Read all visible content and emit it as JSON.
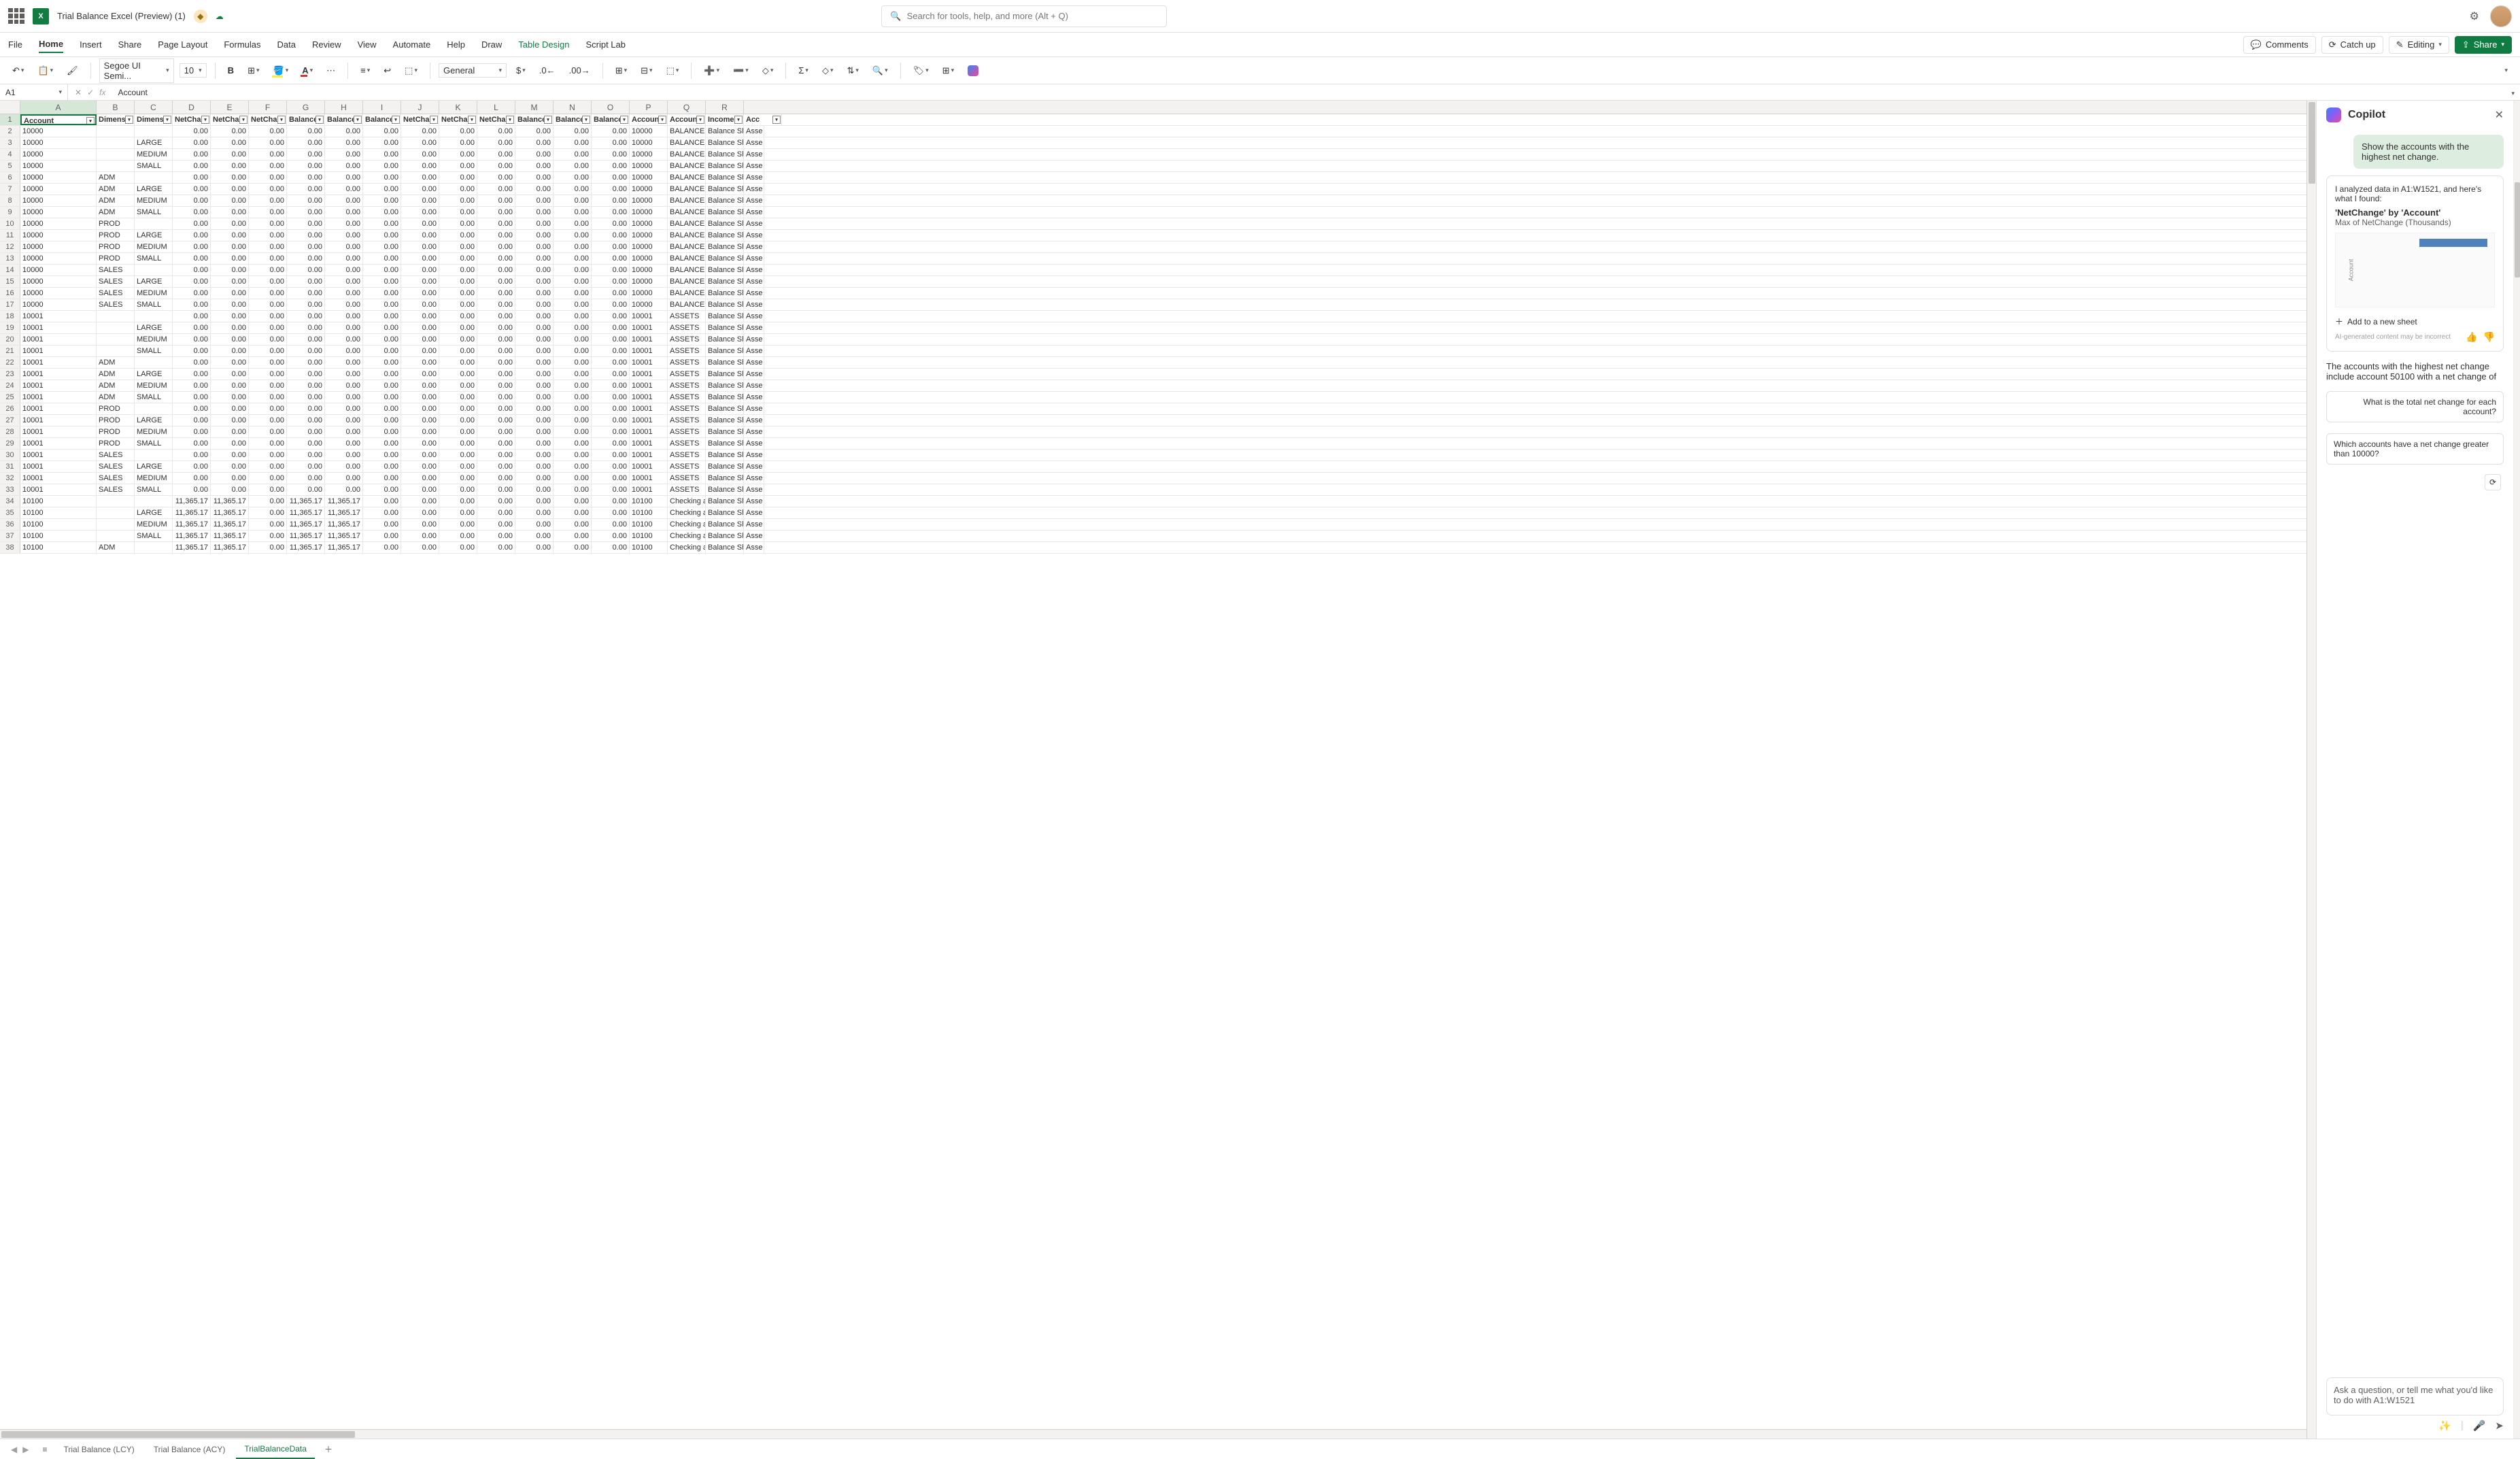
{
  "doc_title": "Trial Balance Excel (Preview) (1)",
  "search_placeholder": "Search for tools, help, and more (Alt + Q)",
  "ribbon_tabs": [
    "File",
    "Home",
    "Insert",
    "Share",
    "Page Layout",
    "Formulas",
    "Data",
    "Review",
    "View",
    "Automate",
    "Help",
    "Draw",
    "Table Design",
    "Script Lab"
  ],
  "ribbon_active": "Home",
  "ribbon_contextual": "Table Design",
  "ribbon_right": {
    "comments": "Comments",
    "catchup": "Catch up",
    "editing": "Editing",
    "share": "Share"
  },
  "toolbar": {
    "font": "Segoe UI Semi...",
    "size": "10",
    "format": "General"
  },
  "name_box": "A1",
  "formula_value": "Account",
  "columns": [
    "A",
    "B",
    "C",
    "D",
    "E",
    "F",
    "G",
    "H",
    "I",
    "J",
    "K",
    "L",
    "M",
    "N",
    "O",
    "P",
    "Q",
    "R"
  ],
  "header_row": [
    "Account",
    "Dimens",
    "Dimens",
    "NetCha",
    "NetCha",
    "NetCha",
    "Balance",
    "Balance",
    "Balance",
    "NetCha",
    "NetCha",
    "NetCha",
    "Balance",
    "Balance",
    "Balance",
    "Accoun",
    "Accoun",
    "Income",
    "Acc"
  ],
  "rows": [
    {
      "n": 2,
      "a": "10000",
      "b": "",
      "c": "",
      "v": "0.00",
      "p": "10000",
      "q": "BALANCE S",
      "r": "Balance Sh",
      "s": "Asse"
    },
    {
      "n": 3,
      "a": "10000",
      "b": "",
      "c": "LARGE",
      "v": "0.00",
      "p": "10000",
      "q": "BALANCE S",
      "r": "Balance Sh",
      "s": "Asse"
    },
    {
      "n": 4,
      "a": "10000",
      "b": "",
      "c": "MEDIUM",
      "v": "0.00",
      "p": "10000",
      "q": "BALANCE S",
      "r": "Balance Sh",
      "s": "Asse"
    },
    {
      "n": 5,
      "a": "10000",
      "b": "",
      "c": "SMALL",
      "v": "0.00",
      "p": "10000",
      "q": "BALANCE S",
      "r": "Balance Sh",
      "s": "Asse"
    },
    {
      "n": 6,
      "a": "10000",
      "b": "ADM",
      "c": "",
      "v": "0.00",
      "p": "10000",
      "q": "BALANCE S",
      "r": "Balance Sh",
      "s": "Asse"
    },
    {
      "n": 7,
      "a": "10000",
      "b": "ADM",
      "c": "LARGE",
      "v": "0.00",
      "p": "10000",
      "q": "BALANCE S",
      "r": "Balance Sh",
      "s": "Asse"
    },
    {
      "n": 8,
      "a": "10000",
      "b": "ADM",
      "c": "MEDIUM",
      "v": "0.00",
      "p": "10000",
      "q": "BALANCE S",
      "r": "Balance Sh",
      "s": "Asse"
    },
    {
      "n": 9,
      "a": "10000",
      "b": "ADM",
      "c": "SMALL",
      "v": "0.00",
      "p": "10000",
      "q": "BALANCE S",
      "r": "Balance Sh",
      "s": "Asse"
    },
    {
      "n": 10,
      "a": "10000",
      "b": "PROD",
      "c": "",
      "v": "0.00",
      "p": "10000",
      "q": "BALANCE S",
      "r": "Balance Sh",
      "s": "Asse"
    },
    {
      "n": 11,
      "a": "10000",
      "b": "PROD",
      "c": "LARGE",
      "v": "0.00",
      "p": "10000",
      "q": "BALANCE S",
      "r": "Balance Sh",
      "s": "Asse"
    },
    {
      "n": 12,
      "a": "10000",
      "b": "PROD",
      "c": "MEDIUM",
      "v": "0.00",
      "p": "10000",
      "q": "BALANCE S",
      "r": "Balance Sh",
      "s": "Asse"
    },
    {
      "n": 13,
      "a": "10000",
      "b": "PROD",
      "c": "SMALL",
      "v": "0.00",
      "p": "10000",
      "q": "BALANCE S",
      "r": "Balance Sh",
      "s": "Asse"
    },
    {
      "n": 14,
      "a": "10000",
      "b": "SALES",
      "c": "",
      "v": "0.00",
      "p": "10000",
      "q": "BALANCE S",
      "r": "Balance Sh",
      "s": "Asse"
    },
    {
      "n": 15,
      "a": "10000",
      "b": "SALES",
      "c": "LARGE",
      "v": "0.00",
      "p": "10000",
      "q": "BALANCE S",
      "r": "Balance Sh",
      "s": "Asse"
    },
    {
      "n": 16,
      "a": "10000",
      "b": "SALES",
      "c": "MEDIUM",
      "v": "0.00",
      "p": "10000",
      "q": "BALANCE S",
      "r": "Balance Sh",
      "s": "Asse"
    },
    {
      "n": 17,
      "a": "10000",
      "b": "SALES",
      "c": "SMALL",
      "v": "0.00",
      "p": "10000",
      "q": "BALANCE S",
      "r": "Balance Sh",
      "s": "Asse"
    },
    {
      "n": 18,
      "a": "10001",
      "b": "",
      "c": "",
      "v": "0.00",
      "p": "10001",
      "q": "ASSETS",
      "r": "Balance Sh",
      "s": "Asse"
    },
    {
      "n": 19,
      "a": "10001",
      "b": "",
      "c": "LARGE",
      "v": "0.00",
      "p": "10001",
      "q": "ASSETS",
      "r": "Balance Sh",
      "s": "Asse"
    },
    {
      "n": 20,
      "a": "10001",
      "b": "",
      "c": "MEDIUM",
      "v": "0.00",
      "p": "10001",
      "q": "ASSETS",
      "r": "Balance Sh",
      "s": "Asse"
    },
    {
      "n": 21,
      "a": "10001",
      "b": "",
      "c": "SMALL",
      "v": "0.00",
      "p": "10001",
      "q": "ASSETS",
      "r": "Balance Sh",
      "s": "Asse"
    },
    {
      "n": 22,
      "a": "10001",
      "b": "ADM",
      "c": "",
      "v": "0.00",
      "p": "10001",
      "q": "ASSETS",
      "r": "Balance Sh",
      "s": "Asse"
    },
    {
      "n": 23,
      "a": "10001",
      "b": "ADM",
      "c": "LARGE",
      "v": "0.00",
      "p": "10001",
      "q": "ASSETS",
      "r": "Balance Sh",
      "s": "Asse"
    },
    {
      "n": 24,
      "a": "10001",
      "b": "ADM",
      "c": "MEDIUM",
      "v": "0.00",
      "p": "10001",
      "q": "ASSETS",
      "r": "Balance Sh",
      "s": "Asse"
    },
    {
      "n": 25,
      "a": "10001",
      "b": "ADM",
      "c": "SMALL",
      "v": "0.00",
      "p": "10001",
      "q": "ASSETS",
      "r": "Balance Sh",
      "s": "Asse"
    },
    {
      "n": 26,
      "a": "10001",
      "b": "PROD",
      "c": "",
      "v": "0.00",
      "p": "10001",
      "q": "ASSETS",
      "r": "Balance Sh",
      "s": "Asse"
    },
    {
      "n": 27,
      "a": "10001",
      "b": "PROD",
      "c": "LARGE",
      "v": "0.00",
      "p": "10001",
      "q": "ASSETS",
      "r": "Balance Sh",
      "s": "Asse"
    },
    {
      "n": 28,
      "a": "10001",
      "b": "PROD",
      "c": "MEDIUM",
      "v": "0.00",
      "p": "10001",
      "q": "ASSETS",
      "r": "Balance Sh",
      "s": "Asse"
    },
    {
      "n": 29,
      "a": "10001",
      "b": "PROD",
      "c": "SMALL",
      "v": "0.00",
      "p": "10001",
      "q": "ASSETS",
      "r": "Balance Sh",
      "s": "Asse"
    },
    {
      "n": 30,
      "a": "10001",
      "b": "SALES",
      "c": "",
      "v": "0.00",
      "p": "10001",
      "q": "ASSETS",
      "r": "Balance Sh",
      "s": "Asse"
    },
    {
      "n": 31,
      "a": "10001",
      "b": "SALES",
      "c": "LARGE",
      "v": "0.00",
      "p": "10001",
      "q": "ASSETS",
      "r": "Balance Sh",
      "s": "Asse"
    },
    {
      "n": 32,
      "a": "10001",
      "b": "SALES",
      "c": "MEDIUM",
      "v": "0.00",
      "p": "10001",
      "q": "ASSETS",
      "r": "Balance Sh",
      "s": "Asse"
    },
    {
      "n": 33,
      "a": "10001",
      "b": "SALES",
      "c": "SMALL",
      "v": "0.00",
      "p": "10001",
      "q": "ASSETS",
      "r": "Balance Sh",
      "s": "Asse"
    },
    {
      "n": 34,
      "a": "10100",
      "b": "",
      "c": "",
      "d": "11,365.17",
      "e": "11,365.17",
      "f": "0.00",
      "g": "11,365.17",
      "h": "11,365.17",
      "v": "0.00",
      "p": "10100",
      "q": "Checking a",
      "r": "Balance Sh",
      "s": "Asse"
    },
    {
      "n": 35,
      "a": "10100",
      "b": "",
      "c": "LARGE",
      "d": "11,365.17",
      "e": "11,365.17",
      "f": "0.00",
      "g": "11,365.17",
      "h": "11,365.17",
      "v": "0.00",
      "p": "10100",
      "q": "Checking a",
      "r": "Balance Sh",
      "s": "Asse"
    },
    {
      "n": 36,
      "a": "10100",
      "b": "",
      "c": "MEDIUM",
      "d": "11,365.17",
      "e": "11,365.17",
      "f": "0.00",
      "g": "11,365.17",
      "h": "11,365.17",
      "v": "0.00",
      "p": "10100",
      "q": "Checking a",
      "r": "Balance Sh",
      "s": "Asse"
    },
    {
      "n": 37,
      "a": "10100",
      "b": "",
      "c": "SMALL",
      "d": "11,365.17",
      "e": "11,365.17",
      "f": "0.00",
      "g": "11,365.17",
      "h": "11,365.17",
      "v": "0.00",
      "p": "10100",
      "q": "Checking a",
      "r": "Balance Sh",
      "s": "Asse"
    },
    {
      "n": 38,
      "a": "10100",
      "b": "ADM",
      "c": "",
      "d": "11,365.17",
      "e": "11,365.17",
      "f": "0.00",
      "g": "11,365.17",
      "h": "11,365.17",
      "v": "0.00",
      "p": "10100",
      "q": "Checking a",
      "r": "Balance Sh",
      "s": "Asse"
    }
  ],
  "sheets": [
    "Trial Balance (LCY)",
    "Trial Balance (ACY)",
    "TrialBalanceData"
  ],
  "active_sheet": "TrialBalanceData",
  "copilot": {
    "title": "Copilot",
    "user_msg": "Show the accounts with the highest net change.",
    "intro": "I analyzed data in A1:W1521, and here's what I found:",
    "card_title": "'NetChange' by 'Account'",
    "card_sub": "Max of NetChange (Thousands)",
    "chart_ylabel": "Account",
    "add_btn": "Add to a new sheet",
    "disclaimer": "AI-generated content may be incorrect",
    "response": "The accounts with the highest net change include account 50100 with a net change of",
    "suggest1": "What is the total net change for each account?",
    "suggest2": "Which accounts have a net change greater than 10000?",
    "input_placeholder": "Ask a question, or tell me what you'd like to do with A1:W1521"
  },
  "chart_data": {
    "type": "bar",
    "orientation": "horizontal",
    "title": "'NetChange' by 'Account'",
    "ylabel": "Account",
    "xlabel": "Max of NetChange (Thousands)",
    "note": "thumbnail — values not legible"
  }
}
